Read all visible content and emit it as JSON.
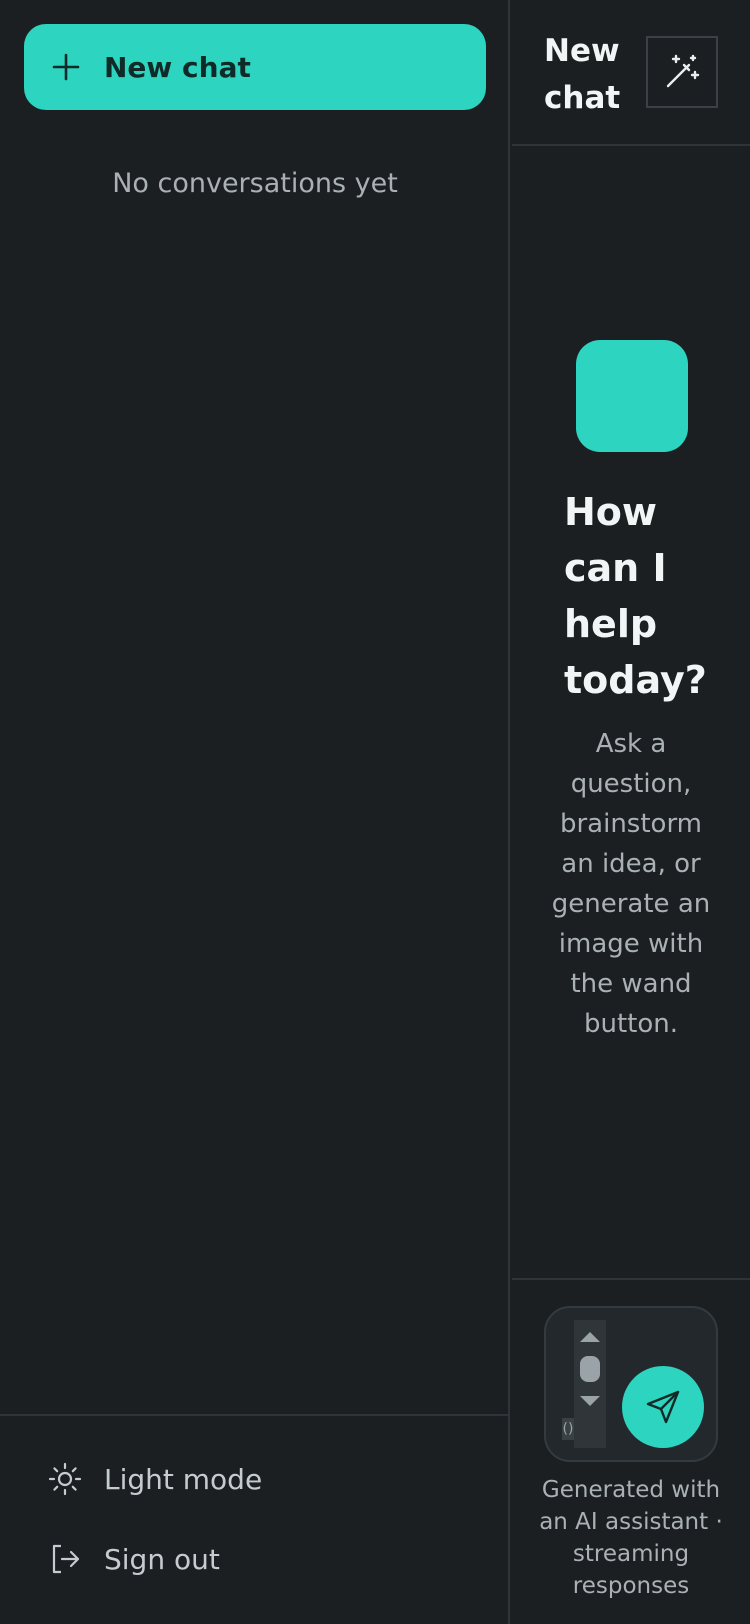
{
  "sidebar": {
    "new_chat_label": "New chat",
    "empty_state": "No conversations yet",
    "footer": {
      "light_mode_label": "Light mode",
      "sign_out_label": "Sign out"
    }
  },
  "main": {
    "header_title": "New chat",
    "hero_title": "How can I help today?",
    "hero_subtitle": "Ask a question, brainstorm an idea, or generate an image with the wand button.",
    "composer": {
      "caret_text": "()",
      "note": "Generated with an AI assistant · streaming responses"
    }
  },
  "icons": {
    "new_chat": "plus-icon",
    "light_mode": "sun-icon",
    "sign_out": "sign-out-icon",
    "wand": "magic-wand-icon",
    "send": "send-icon"
  },
  "colors": {
    "accent": "#2dd4bf",
    "background": "#1b1f22",
    "border": "#2e3438",
    "text_primary": "#f2f5f6",
    "text_muted": "#a9b1b5"
  }
}
